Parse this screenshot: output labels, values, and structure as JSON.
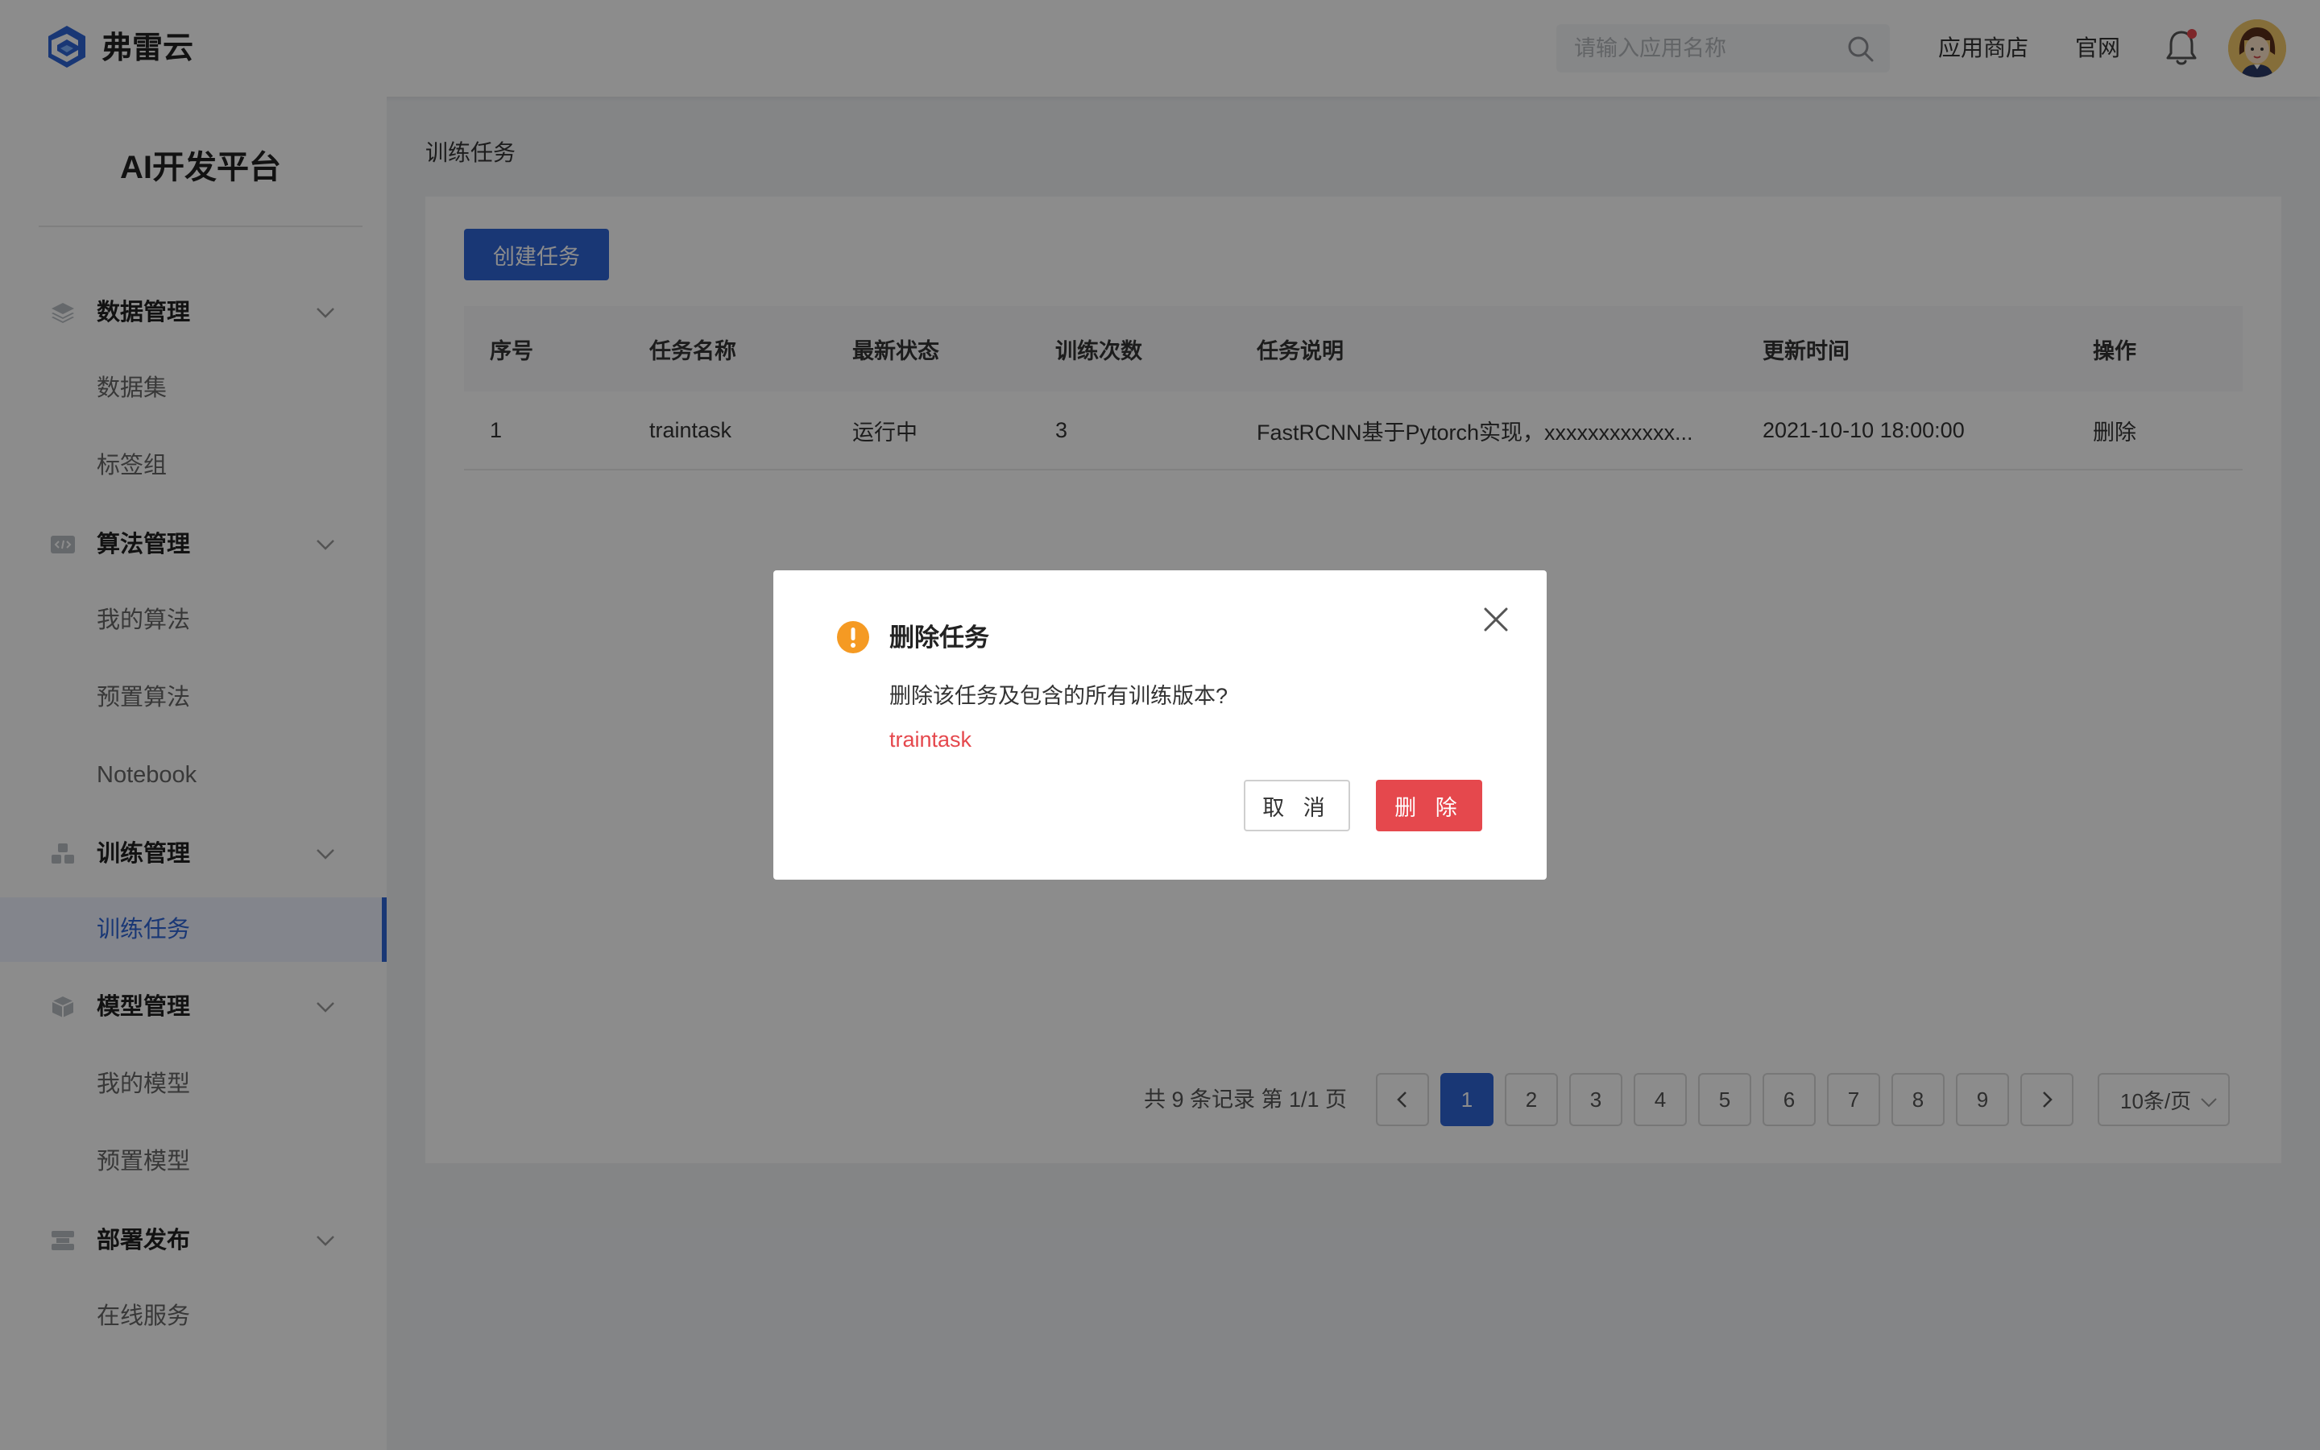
{
  "header": {
    "brand": "弗雷云",
    "search_placeholder": "请输入应用名称",
    "links": [
      "应用商店",
      "官网"
    ],
    "notification_dot_color": "#e5484d"
  },
  "sidebar": {
    "platform_title": "AI开发平台",
    "groups": [
      {
        "label": "数据管理",
        "icon": "layers-icon",
        "items": [
          "数据集",
          "标签组"
        ]
      },
      {
        "label": "算法管理",
        "icon": "code-icon",
        "items": [
          "我的算法",
          "预置算法",
          "Notebook"
        ]
      },
      {
        "label": "训练管理",
        "icon": "blocks-icon",
        "items": [
          "训练任务"
        ]
      },
      {
        "label": "模型管理",
        "icon": "cube-icon",
        "items": [
          "我的模型",
          "预置模型"
        ]
      },
      {
        "label": "部署发布",
        "icon": "server-icon",
        "items": [
          "在线服务"
        ]
      }
    ],
    "active_item": "训练任务"
  },
  "main": {
    "breadcrumb": "训练任务",
    "create_button": "创建任务",
    "table": {
      "columns": [
        "序号",
        "任务名称",
        "最新状态",
        "训练次数",
        "任务说明",
        "更新时间",
        "操作"
      ],
      "rows": [
        {
          "index": "1",
          "name": "traintask",
          "status": "运行中",
          "count": "3",
          "desc": "FastRCNN基于Pytorch实现，xxxxxxxxxxxx...",
          "updated": "2021-10-10 18:00:00",
          "action": "删除"
        }
      ]
    },
    "pagination": {
      "summary": "共 9 条记录 第 1/1 页",
      "pages": [
        "1",
        "2",
        "3",
        "4",
        "5",
        "6",
        "7",
        "8",
        "9"
      ],
      "current": "1",
      "page_size": "10条/页"
    }
  },
  "modal": {
    "title": "删除任务",
    "message": "删除该任务及包含的所有训练版本?",
    "target": "traintask",
    "cancel": "取 消",
    "confirm": "删 除"
  },
  "colors": {
    "primary": "#2f64d6",
    "danger": "#e5484d",
    "warning": "#f59a23"
  }
}
